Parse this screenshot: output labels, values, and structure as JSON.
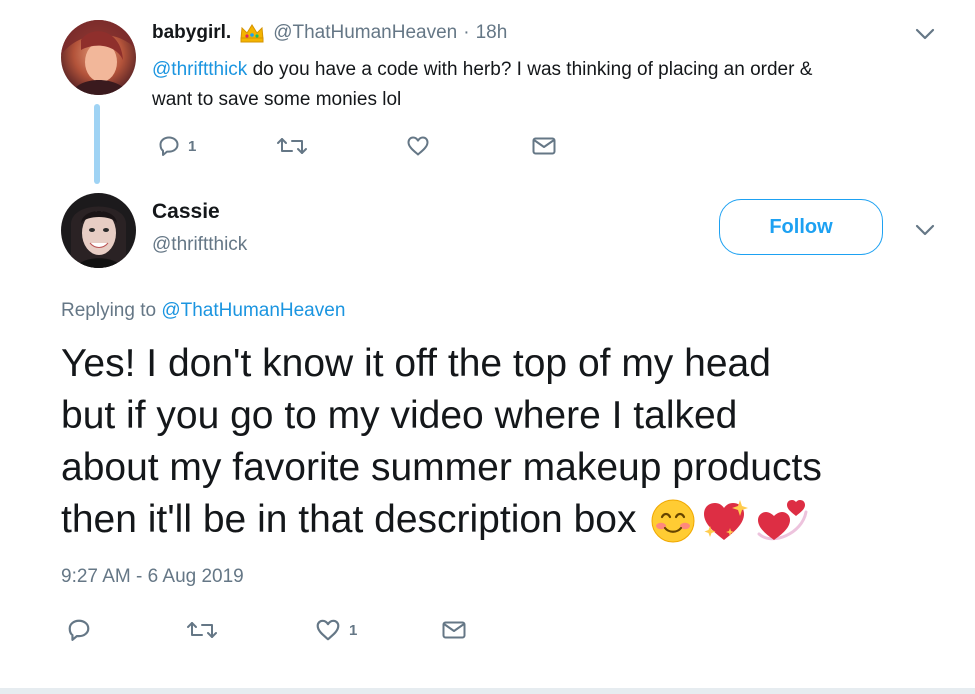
{
  "parent_tweet": {
    "display_name": "babygirl.",
    "name_badge_icon": "crown-emoji",
    "handle": "@ThatHumanHeaven",
    "separator": "·",
    "time": "18h",
    "text_mention": "@thriftthick",
    "text_line1_rest": " do you have a code with herb? I was thinking of placing an order &",
    "text_line2": "want to save some monies lol",
    "actions": {
      "reply_icon": "reply-icon",
      "reply_count": "1",
      "retweet_icon": "retweet-icon",
      "like_icon": "heart-icon",
      "dm_icon": "envelope-icon"
    }
  },
  "main_tweet": {
    "display_name": "Cassie",
    "handle": "@thriftthick",
    "follow_label": "Follow",
    "replying_prefix": "Replying to ",
    "replying_to": "@ThatHumanHeaven",
    "text_lines": [
      "Yes! I don't know it off the top of my head",
      "but if you go to my video where I talked",
      "about my favorite summer makeup products",
      "then it'll be in that description box"
    ],
    "emojis": [
      "smiling-blushing-emoji",
      "sparkling-heart-emoji",
      "revolving-hearts-emoji"
    ],
    "timestamp": "9:27 AM - 6 Aug 2019",
    "actions": {
      "reply_icon": "reply-icon",
      "retweet_icon": "retweet-icon",
      "like_icon": "heart-icon",
      "like_count": "1",
      "dm_icon": "envelope-icon"
    }
  },
  "colors": {
    "link": "#1b95e0",
    "accent": "#1da1f2",
    "muted": "#657786",
    "thread_line": "#9fd3f4",
    "text": "#14171a"
  }
}
